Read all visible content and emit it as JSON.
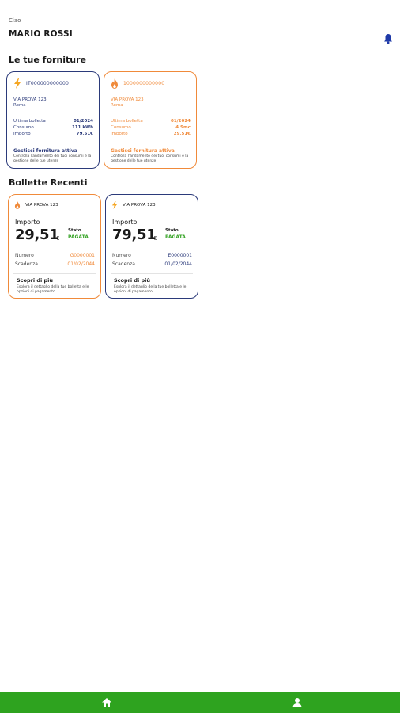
{
  "header": {
    "greeting": "Ciao",
    "user_name": "MARIO ROSSI",
    "notifications_icon": "bell-icon"
  },
  "supplies": {
    "title": "Le tue forniture",
    "items": [
      {
        "type": "electricity",
        "icon": "lightning-icon",
        "code": "IT000000000000",
        "address_line1": "VIA PROVA 123",
        "address_line2": "Roma",
        "rows": [
          {
            "label": "Ultima bolletta",
            "value": "01/2024"
          },
          {
            "label": "Consumo",
            "value": "111 kWh"
          },
          {
            "label": "Importo",
            "value": "79,51€"
          }
        ],
        "link": "Gestisci fornitura attiva",
        "description": "Controlla l'andamento dei tuoi consumi e la gestione delle tue utenze"
      },
      {
        "type": "gas",
        "icon": "flame-icon",
        "code": "1000000000000",
        "address_line1": "VIA PROVA 123",
        "address_line2": "Roma",
        "rows": [
          {
            "label": "Ultima bolletta",
            "value": "01/2024"
          },
          {
            "label": "Consumo",
            "value": "4 Smc"
          },
          {
            "label": "Importo",
            "value": "29,51€"
          }
        ],
        "link": "Gestisci fornitura attiva",
        "description": "Controlla l'andamento dei tuoi consumi e la gestione delle tue utenze"
      }
    ]
  },
  "bills": {
    "title": "Bollette Recenti",
    "items": [
      {
        "type": "gas",
        "icon": "flame-icon",
        "address": "VIA PROVA 123",
        "amount_label": "Importo",
        "amount": "29,51",
        "currency": "€",
        "status_label": "Stato",
        "status": "PAGATA",
        "number_label": "Numero",
        "number": "G0000001",
        "due_label": "Scadenza",
        "due": "01/02/2044",
        "link": "Scopri di più",
        "description": "Esplora il dettaglio della tue bolletta e le opzioni di pagamento"
      },
      {
        "type": "electricity",
        "icon": "lightning-icon",
        "address": "VIA PROVA 123",
        "amount_label": "Importo",
        "amount": "79,51",
        "currency": "€",
        "status_label": "Stato",
        "status": "PAGATA",
        "number_label": "Numero",
        "number": "E0000001",
        "due_label": "Scadenza",
        "due": "01/02/2044",
        "link": "Scopri di più",
        "description": "Esplora il dettaglio della tue bolletta e le opzioni di pagamento"
      }
    ]
  },
  "bottom_nav": {
    "items": [
      {
        "icon": "home-icon"
      },
      {
        "icon": "profile-icon"
      }
    ]
  },
  "colors": {
    "electric": "#2b3a7a",
    "gas": "#f08a3a",
    "paid": "#3aa52a",
    "nav": "#2ea31f",
    "bell": "#1f3aa8"
  }
}
